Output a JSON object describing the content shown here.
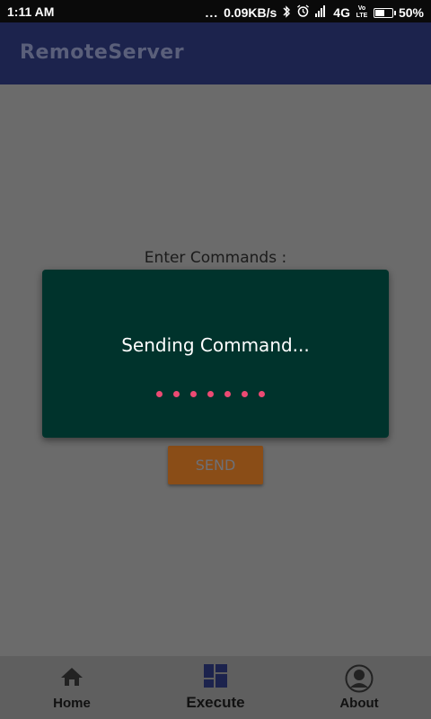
{
  "status_bar": {
    "time": "1:11 AM",
    "dots": "...",
    "speed": "0.09KB/s",
    "network": "4G",
    "volte": "Vo LTE",
    "battery_percent": "50%",
    "battery_level": 0.5,
    "icons": [
      "bluetooth-icon",
      "alarm-icon",
      "signal-icon",
      "battery-charging-icon"
    ]
  },
  "app_bar": {
    "title": "RemoteServer"
  },
  "form": {
    "label": "Enter Commands :",
    "send_label": "SEND"
  },
  "dialog": {
    "message": "Sending Command...",
    "dot_color": "#ec4a73",
    "dot_count": 7
  },
  "bottom_nav": {
    "items": [
      {
        "label": "Home",
        "icon": "home-icon"
      },
      {
        "label": "Execute",
        "icon": "dashboard-icon",
        "selected": true
      },
      {
        "label": "About",
        "icon": "account-icon"
      }
    ]
  },
  "colors": {
    "app_bar": "#1c234d",
    "dialog_bg": "#00332c",
    "send_button": "#8a4d17",
    "overlay_bg": "#6b6b6b",
    "nav_bg": "#5f5f5f"
  }
}
